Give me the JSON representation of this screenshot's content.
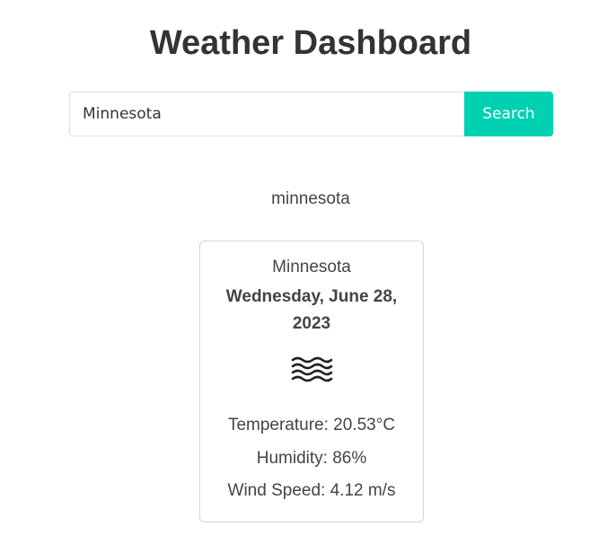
{
  "header": {
    "title": "Weather Dashboard"
  },
  "search": {
    "value": "Minnesota",
    "button_label": "Search"
  },
  "results": {
    "query_label": "minnesota"
  },
  "card": {
    "city": "Minnesota",
    "date": "Wednesday, June 28, 2023",
    "icon": "mist-icon",
    "temperature": "Temperature: 20.53°C",
    "humidity": "Humidity: 86%",
    "wind": "Wind Speed: 4.12 m/s"
  },
  "colors": {
    "accent": "#00d1b2",
    "text": "#333333",
    "border": "#d6d6d6"
  }
}
